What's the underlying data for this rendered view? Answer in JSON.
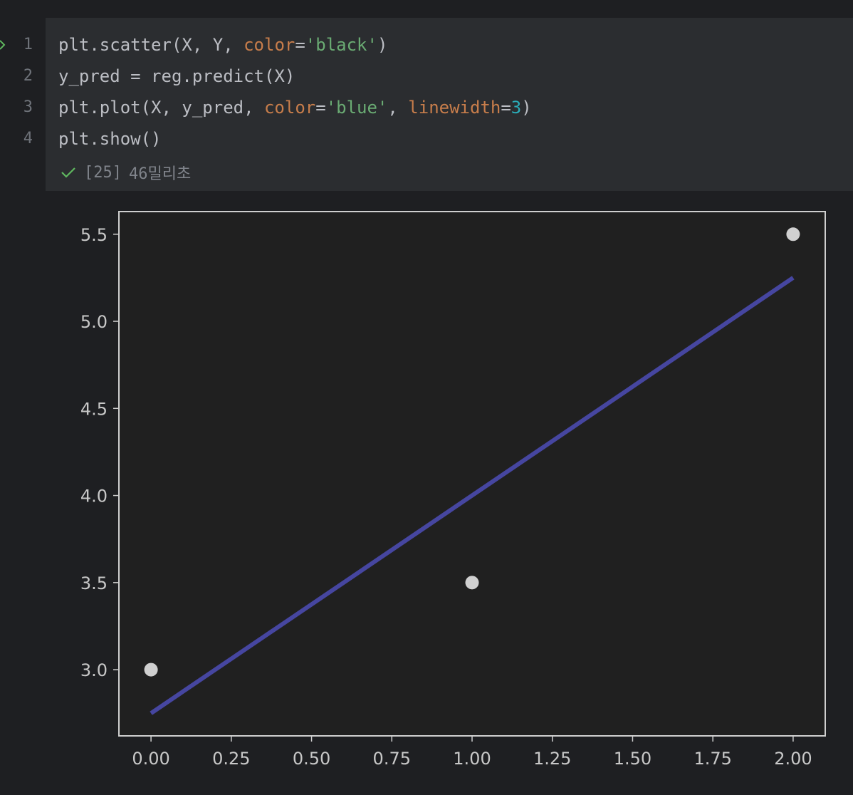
{
  "cell": {
    "line_numbers": [
      "1",
      "2",
      "3",
      "4"
    ],
    "code_lines": [
      [
        {
          "t": "plt.scatter(X, Y, ",
          "c": "plain"
        },
        {
          "t": "color",
          "c": "kw"
        },
        {
          "t": "=",
          "c": "plain"
        },
        {
          "t": "'black'",
          "c": "str"
        },
        {
          "t": ")",
          "c": "plain"
        }
      ],
      [
        {
          "t": "y_pred = reg.predict(X)",
          "c": "plain"
        }
      ],
      [
        {
          "t": "plt.plot(X, y_pred, ",
          "c": "plain"
        },
        {
          "t": "color",
          "c": "kw"
        },
        {
          "t": "=",
          "c": "plain"
        },
        {
          "t": "'blue'",
          "c": "str"
        },
        {
          "t": ", ",
          "c": "plain"
        },
        {
          "t": "linewidth",
          "c": "kw"
        },
        {
          "t": "=",
          "c": "plain"
        },
        {
          "t": "3",
          "c": "num"
        },
        {
          "t": ")",
          "c": "plain"
        }
      ],
      [
        {
          "t": "plt.show()",
          "c": "plain"
        }
      ]
    ],
    "status": {
      "icon": "check-icon",
      "exec_count": "[25]",
      "duration": "46밀리초"
    }
  },
  "colors": {
    "background": "#1e1f22",
    "cell_background": "#2b2d30",
    "plot_background": "#202020",
    "line_color": "#4646a0",
    "point_color": "#d0d0d0",
    "check_color": "#5fb85f"
  },
  "chart_data": {
    "type": "scatter",
    "title": "",
    "xlabel": "",
    "ylabel": "",
    "xlim": [
      -0.1,
      2.1
    ],
    "ylim": [
      2.62,
      5.63
    ],
    "xticks": [
      "0.00",
      "0.25",
      "0.50",
      "0.75",
      "1.00",
      "1.25",
      "1.50",
      "1.75",
      "2.00"
    ],
    "yticks": [
      "3.0",
      "3.5",
      "4.0",
      "4.5",
      "5.0",
      "5.5"
    ],
    "grid": false,
    "series": [
      {
        "type": "scatter",
        "x": [
          0,
          1,
          2
        ],
        "y": [
          3.0,
          3.5,
          5.5
        ]
      },
      {
        "type": "line",
        "x": [
          0,
          2
        ],
        "y": [
          2.75,
          5.25
        ]
      }
    ]
  }
}
